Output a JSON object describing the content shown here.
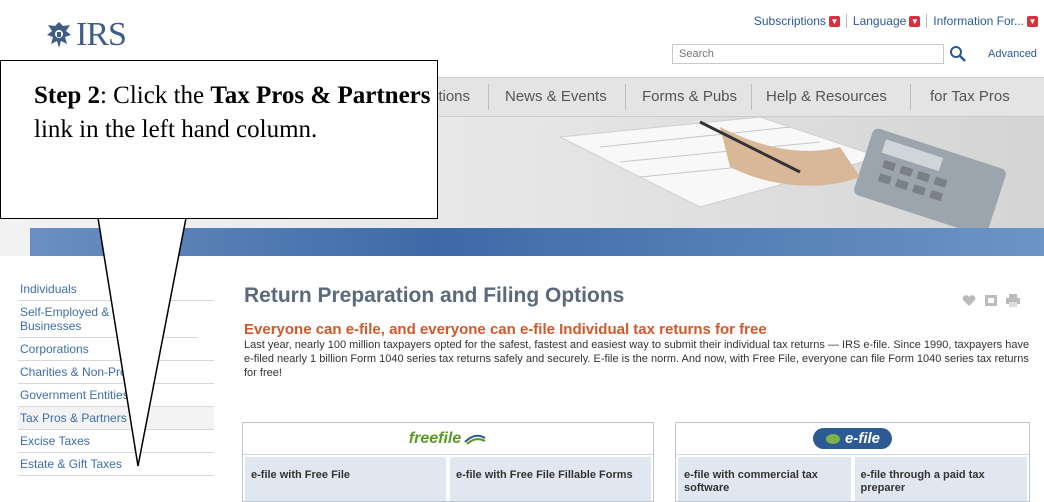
{
  "header": {
    "logo_text": "IRS",
    "utility": [
      {
        "label": "Subscriptions"
      },
      {
        "label": "Language"
      },
      {
        "label": "Information For..."
      }
    ],
    "search_placeholder": "Search",
    "advanced_label": "Advanced"
  },
  "nav": {
    "tabs": [
      {
        "label": "ptions"
      },
      {
        "label": "News & Events"
      },
      {
        "label": "Forms & Pubs"
      },
      {
        "label": "Help & Resources"
      },
      {
        "label": "for Tax Pros"
      }
    ]
  },
  "sidebar": {
    "items": [
      {
        "label": "Individuals"
      },
      {
        "label": "Self-Employed & Small Businesses"
      },
      {
        "label": "Corporations"
      },
      {
        "label": "Charities & Non-Profits"
      },
      {
        "label": "Government Entities"
      },
      {
        "label": "Tax Pros & Partners"
      },
      {
        "label": "Excise Taxes"
      },
      {
        "label": "Estate & Gift Taxes"
      }
    ]
  },
  "main": {
    "title": "Return Preparation and Filing Options",
    "headline": "Everyone can e-file, and everyone can e-file Individual tax returns for free",
    "body": "Last year, nearly 100 million taxpayers opted for the safest, fastest and easiest way to submit their individual tax returns — IRS e-file. Since 1990, taxpayers have e-filed nearly 1 billion Form 1040 series tax returns safely and securely. E-file is the norm. And now, with Free File, everyone can file Form 1040 series tax returns for free!",
    "freefile": {
      "logo": "freefile",
      "links": [
        "e-file with Free File",
        "e-file with Free File Fillable Forms"
      ]
    },
    "efile": {
      "logo": "e-file",
      "links": [
        "e-file with commercial tax software",
        "e-file through a paid tax preparer"
      ]
    }
  },
  "callout": {
    "step": "Step 2",
    "text_1": ": Click the ",
    "link_name": "Tax Pros & Partners",
    "text_2": " link in the left hand column."
  },
  "colors": {
    "logo": "#3e5d87",
    "link": "#3e6ea8",
    "headline": "#d4572a",
    "accent_red": "#d6323b"
  }
}
